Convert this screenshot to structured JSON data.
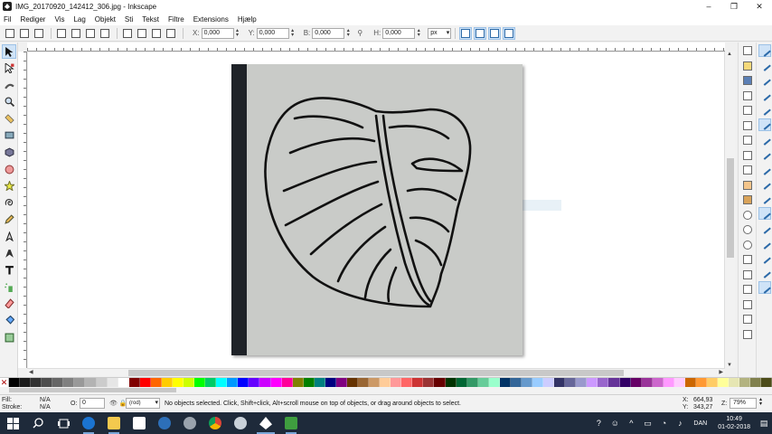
{
  "window": {
    "title": "IMG_20170920_142412_306.jpg - Inkscape",
    "minimize": "–",
    "maximize": "❐",
    "close": "✕"
  },
  "menu": [
    "Fil",
    "Rediger",
    "Vis",
    "Lag",
    "Objekt",
    "Sti",
    "Tekst",
    "Filtre",
    "Extensions",
    "Hjælp"
  ],
  "toolbar": {
    "x_label": "X:",
    "x_value": "0,000",
    "y_label": "Y:",
    "y_value": "0,000",
    "w_label": "B:",
    "w_value": "0,000",
    "h_label": "H:",
    "h_value": "0,000",
    "unit": "px"
  },
  "status": {
    "fill_label": "Fill:",
    "fill_value": "N/A",
    "stroke_label": "Stroke:",
    "stroke_value": "N/A",
    "opacity_label": "O:",
    "opacity_value": "0",
    "layer": "(rod)",
    "message": "No objects selected. Click, Shift+click, Alt+scroll mouse on top of objects, or drag around objects to select.",
    "cursor_x_label": "X:",
    "cursor_x": "664,93",
    "cursor_y_label": "Y:",
    "cursor_y": "343,27",
    "zoom_label": "Z:",
    "zoom": "79%"
  },
  "palette": {
    "colors": [
      "#000000",
      "#1a1a1a",
      "#333333",
      "#4d4d4d",
      "#666666",
      "#808080",
      "#999999",
      "#b3b3b3",
      "#cccccc",
      "#e6e6e6",
      "#ffffff",
      "#800000",
      "#ff0000",
      "#ff6600",
      "#ffcc00",
      "#ffff00",
      "#ccff00",
      "#00ff00",
      "#00cc66",
      "#00ffff",
      "#0099ff",
      "#0000ff",
      "#6600ff",
      "#cc00ff",
      "#ff00ff",
      "#ff0099",
      "#808000",
      "#008000",
      "#008080",
      "#000080",
      "#800080",
      "#663300",
      "#996633",
      "#cc9966",
      "#ffcc99",
      "#ff9999",
      "#ff6666",
      "#cc3333",
      "#993333",
      "#660000",
      "#003300",
      "#006633",
      "#339966",
      "#66cc99",
      "#99ffcc",
      "#003366",
      "#336699",
      "#6699cc",
      "#99ccff",
      "#ccccff",
      "#333366",
      "#666699",
      "#9999cc",
      "#cc99ff",
      "#9966cc",
      "#663399",
      "#330066",
      "#660066",
      "#993399",
      "#cc66cc",
      "#ff99ff",
      "#ffccff",
      "#cc6600",
      "#ff9933",
      "#ffcc66",
      "#ffff99",
      "#e6e6b3",
      "#b3b380",
      "#80804d",
      "#4d4d1a"
    ]
  },
  "taskbar": {
    "lang": "DAN",
    "time": "10:49",
    "date": "01-02-2018"
  }
}
